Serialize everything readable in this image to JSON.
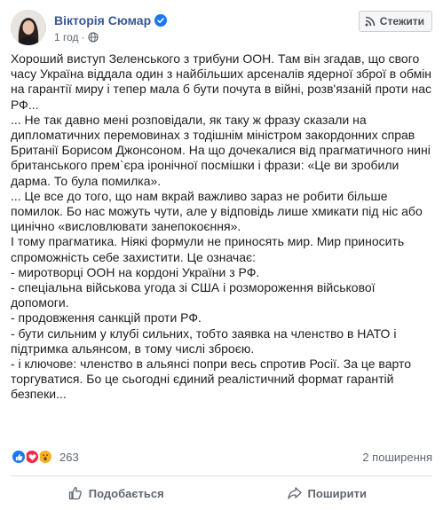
{
  "post": {
    "author": "Вікторія Сюмар",
    "time": "1 год",
    "follow_label": "Стежити",
    "paragraphs": [
      "Хороший виступ Зеленського з трибуни ООН. Там він згадав, що свого часу Україна віддала один з найбільших арсеналів ядерної зброї в обмін на гарантії миру і тепер мала б бути почута в війні, розв'язаній проти нас РФ...",
      "... Не так давно мені розповідали, як таку ж фразу сказали на дипломатичних перемовинах з тодішнім міністром закордонних справ Британії Борисом Джонсоном. На що дочекалися від прагматичного нині британського прем`єра іронічної посмішки і фрази: «Це ви зробили дарма. То була помилка».",
      "... Це все до того, що нам вкрай важливо зараз не робити більше помилок. Бо нас можуть чути, але у відповідь лише хмикати під ніс або цинічно «висловлювати занепокоєння».",
      "І тому прагматика. Ніякі формули не приносять мир. Мир приносить спроможність себе захистити. Це означає:",
      "- миротворці ООН на кордоні України з РФ.",
      "- спеціальна військова угода зі США і розмороження військової допомоги.",
      "- продовження санкцій проти РФ.",
      "- бути сильним у клубі сильних, тобто заявка на членство в НАТО і підтримка альянсом, в тому числі зброєю.",
      "- і ключове: членство в альянсі попри весь спротив Росії. За це варто торгуватися. Бо це сьогодні єдиний реалістичний формат гарантій безпеки..."
    ]
  },
  "reactions": {
    "count": "263",
    "shares": "2 поширення",
    "icons": [
      "like-icon",
      "love-icon",
      "wow-icon"
    ]
  },
  "actions": {
    "like_label": "Подобається",
    "share_label": "Поширити"
  },
  "colors": {
    "author": "#385898",
    "like": "#1877f2",
    "love": "#f0284a",
    "wow": "#f7b125"
  }
}
